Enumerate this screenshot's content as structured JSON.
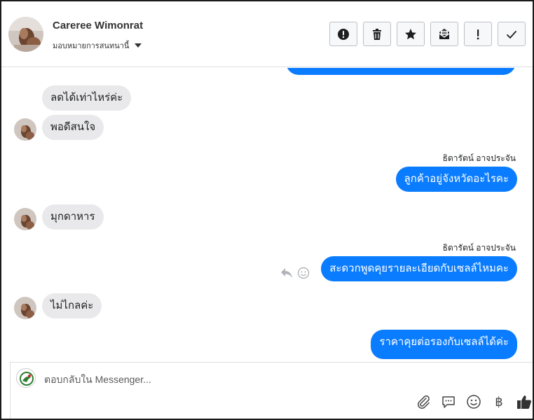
{
  "header": {
    "contact_name": "Careree Wimonrat",
    "assign_label": "มอบหมายการสนทนานี้",
    "actions": [
      {
        "name": "spam-button",
        "icon": "alert-circle-icon"
      },
      {
        "name": "delete-button",
        "icon": "trash-icon"
      },
      {
        "name": "star-button",
        "icon": "star-icon"
      },
      {
        "name": "mark-unread-button",
        "icon": "envelope-icon"
      },
      {
        "name": "follow-up-button",
        "icon": "exclamation-icon"
      },
      {
        "name": "done-button",
        "icon": "check-icon"
      }
    ]
  },
  "messages": {
    "m1": "ลดได้เท่าไหร่ค่ะ",
    "m2": "พอดีสนใจ",
    "m3_sender": "ธิดารัตน์ อาจประจัน",
    "m3": "ลูกค้าอยู่จังหวัดอะไรคะ",
    "m4": "มุกดาหาร",
    "m5_sender": "ธิดารัตน์ อาจประจัน",
    "m5": "สะดวกพูดคุยรายละเอียดกับเซลล์ไหมคะ",
    "m6": "ไม่ไกลค่ะ",
    "m7": "ราคาคุยต่อรองกับเซลล์ได้ค่ะ"
  },
  "composer": {
    "placeholder": "ตอบกลับใน Messenger...",
    "currency_symbol": "฿"
  },
  "colors": {
    "outgoing": "#0a7cff",
    "incoming": "#e9e9eb"
  }
}
